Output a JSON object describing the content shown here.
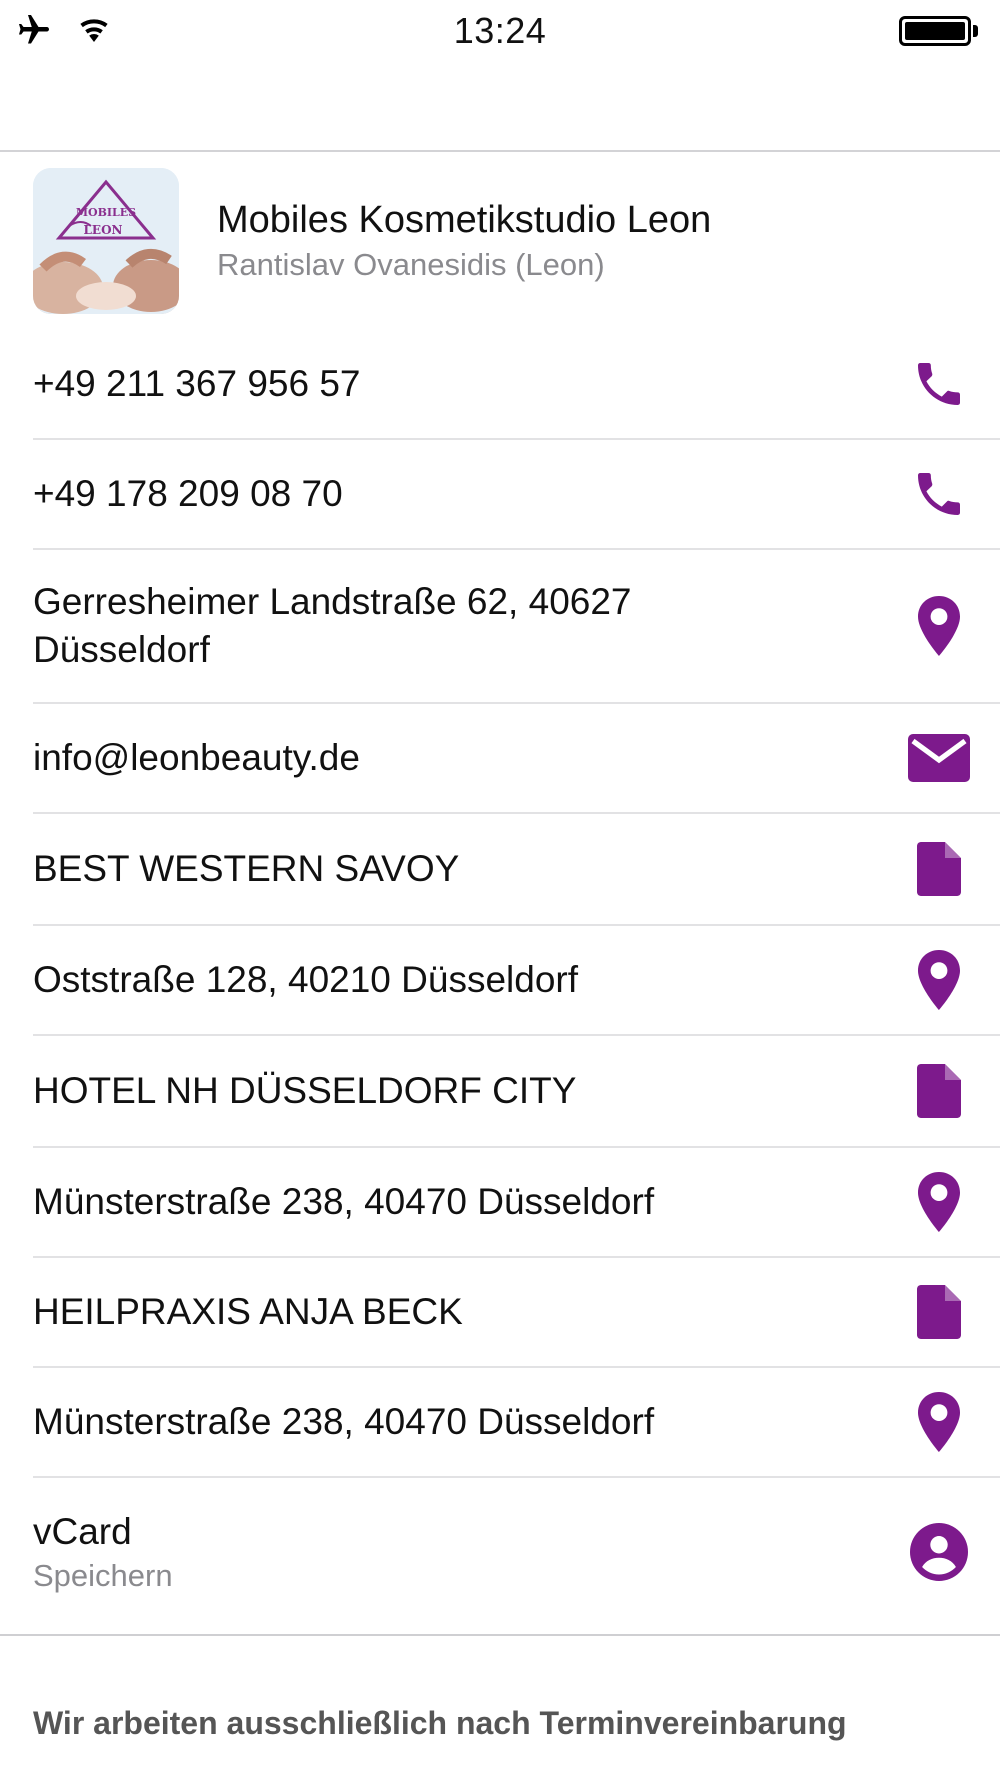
{
  "status_bar": {
    "time": "13:24",
    "left_icons": [
      "airplane-icon",
      "wifi-icon"
    ],
    "right_icons": [
      "battery-icon"
    ]
  },
  "header": {
    "logo": "business-logo",
    "title": "Mobiles Kosmetikstudio Leon",
    "subtitle": "Rantislav Ovanesidis (Leon)"
  },
  "accent_color": "#7d1a8c",
  "rows": [
    {
      "text": "+49 211 367 956 57",
      "icon": "phone-icon"
    },
    {
      "text": "+49 178 209 08 70",
      "icon": "phone-icon"
    },
    {
      "text": "Gerresheimer Landstraße 62, 40627 Düsseldorf",
      "icon": "map-pin-icon"
    },
    {
      "text": "info@leonbeauty.de",
      "icon": "mail-icon"
    },
    {
      "text": "BEST WESTERN SAVOY",
      "icon": "document-icon"
    },
    {
      "text": "Oststraße 128, 40210 Düsseldorf",
      "icon": "map-pin-icon"
    },
    {
      "text": "HOTEL NH DÜSSELDORF CITY",
      "icon": "document-icon"
    },
    {
      "text": "Münsterstraße 238, 40470 Düsseldorf",
      "icon": "map-pin-icon"
    },
    {
      "text": "HEILPRAXIS ANJA BECK",
      "icon": "document-icon"
    },
    {
      "text": "Münsterstraße 238, 40470 Düsseldorf",
      "icon": "map-pin-icon"
    }
  ],
  "vcard": {
    "title": "vCard",
    "subtitle": "Speichern",
    "icon": "person-circle-icon"
  },
  "footer_text": "Wir arbeiten ausschließlich nach Terminvereinbarung"
}
